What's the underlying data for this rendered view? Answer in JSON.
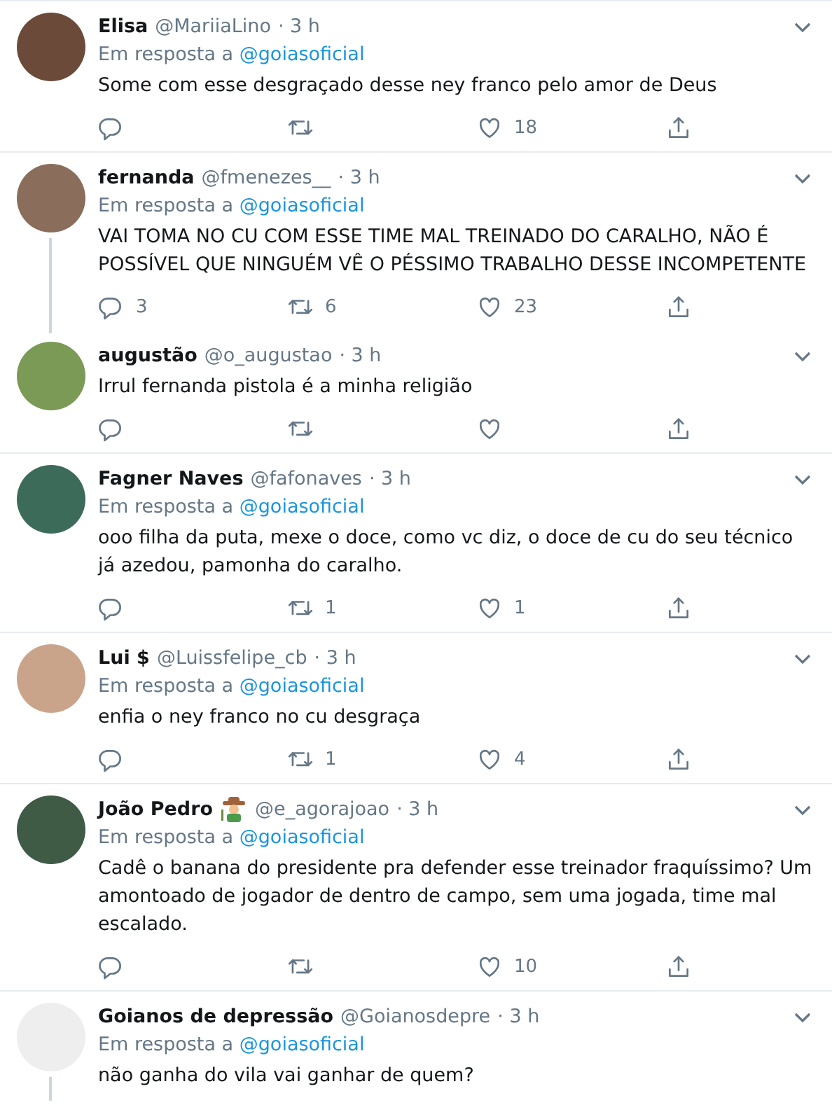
{
  "tweets": [
    {
      "name": "Elisa",
      "handle": "@MariiaLino",
      "time": "· 3 h",
      "reply_prefix": "Em resposta a",
      "reply_to": "@goiasoficial",
      "text": "Some com esse desgraçado desse ney franco pelo amor de Deus",
      "likes": "18",
      "thread_line": false
    },
    {
      "name": "fernanda",
      "handle": "@fmenezes__",
      "time": "· 3 h",
      "reply_prefix": "Em resposta a",
      "reply_to": "@goiasoficial",
      "text": "VAI TOMA NO CU COM ESSE TIME MAL TREINADO DO CARALHO, NÃO É POSSÍVEL QUE NINGUÉM VÊ O PÉSSIMO TRABALHO DESSE INCOMPETENTE",
      "replies": "3",
      "retweets": "6",
      "likes": "23",
      "thread_line": true
    },
    {
      "name": "augustão",
      "handle": "@o_augustao",
      "time": "· 3 h",
      "text": "Irrul fernanda pistola é a minha religião",
      "thread_line": false
    },
    {
      "name": "Fagner Naves",
      "handle": "@fafonaves",
      "time": "· 3 h",
      "reply_prefix": "Em resposta a",
      "reply_to": "@goiasoficial",
      "text": "ooo filha da puta, mexe o doce, como vc diz, o doce de cu do seu técnico já azedou, pamonha do caralho.",
      "retweets": "1",
      "likes": "1",
      "thread_line": false
    },
    {
      "name": "Lui $",
      "handle": "@Luissfelipe_cb",
      "time": "· 3 h",
      "reply_prefix": "Em resposta a",
      "reply_to": "@goiasoficial",
      "text": "enfia o ney franco no cu desgraça",
      "retweets": "1",
      "likes": "4",
      "thread_line": false
    },
    {
      "name": "João Pedro",
      "name_emoji": true,
      "handle": "@e_agorajoao",
      "time": "· 3 h",
      "reply_prefix": "Em resposta a",
      "reply_to": "@goiasoficial",
      "text": "Cadê o banana do presidente pra defender esse treinador fraquíssimo? Um amontoado de jogador de dentro de campo, sem uma jogada, time mal escalado.",
      "likes": "10",
      "thread_line": false
    },
    {
      "name": "Goianos de depressão",
      "handle": "@Goianosdepre",
      "time": "· 3 h",
      "reply_prefix": "Em resposta a",
      "reply_to": "@goiasoficial",
      "text": "não ganha do vila vai ganhar de quem?",
      "thread_line": true,
      "actions_hidden": true
    }
  ]
}
